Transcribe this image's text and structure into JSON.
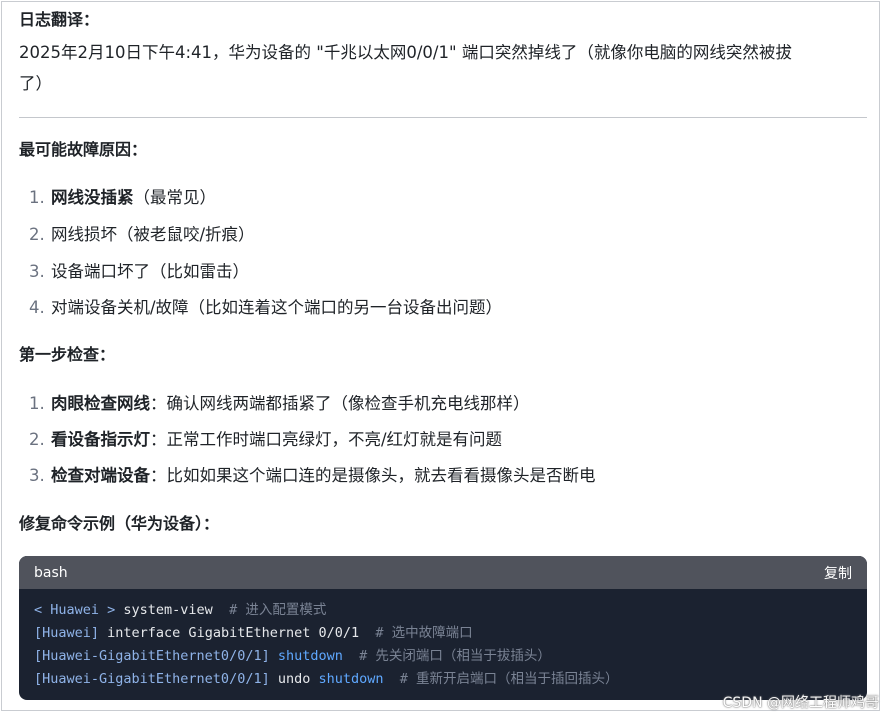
{
  "log": {
    "heading": "日志翻译：",
    "line1": "2025年2月10日下午4:41，华为设备的 \"千兆以太网0/0/1\" 端口突然掉线了（就像你电脑的网线突然被拔",
    "line2": "了）"
  },
  "causes": {
    "heading": "最可能故障原因：",
    "items": [
      {
        "num": "1.",
        "bold": "网线没插紧",
        "text": "（最常见）"
      },
      {
        "num": "2.",
        "bold": "",
        "text": "网线损坏（被老鼠咬/折痕）"
      },
      {
        "num": "3.",
        "bold": "",
        "text": "设备端口坏了（比如雷击）"
      },
      {
        "num": "4.",
        "bold": "",
        "text": "对端设备关机/故障（比如连着这个端口的另一台设备出问题）"
      }
    ]
  },
  "steps": {
    "heading": "第一步检查：",
    "items": [
      {
        "num": "1.",
        "bold": "肉眼检查网线",
        "text": "：确认网线两端都插紧了（像检查手机充电线那样）"
      },
      {
        "num": "2.",
        "bold": "看设备指示灯",
        "text": "：正常工作时端口亮绿灯，不亮/红灯就是有问题"
      },
      {
        "num": "3.",
        "bold": "检查对端设备",
        "text": "：比如如果这个端口连的是摄像头，就去看看摄像头是否断电"
      }
    ]
  },
  "repair": {
    "heading": "修复命令示例（华为设备）："
  },
  "code": {
    "lang": "bash",
    "copy_label": "复制",
    "lines": [
      {
        "prompt": "< Huawei >",
        "cmd": " system-view",
        "kw": "",
        "rest": "",
        "comment": "# 进入配置模式"
      },
      {
        "prompt": "[Huawei]",
        "cmd": " interface GigabitEthernet ",
        "kw": "",
        "rest": "0/0/1",
        "comment": "# 选中故障端口"
      },
      {
        "prompt": "[Huawei-GigabitEthernet0/0/1]",
        "cmd": " ",
        "kw": "shutdown",
        "rest": "",
        "comment": "# 先关闭端口（相当于拔插头）"
      },
      {
        "prompt": "[Huawei-GigabitEthernet0/0/1]",
        "cmd": " undo ",
        "kw": "shutdown",
        "rest": "",
        "comment": "# 重新开启端口（相当于插回插头）"
      }
    ]
  },
  "watermark": "CSDN @网络工程师鸡哥"
}
